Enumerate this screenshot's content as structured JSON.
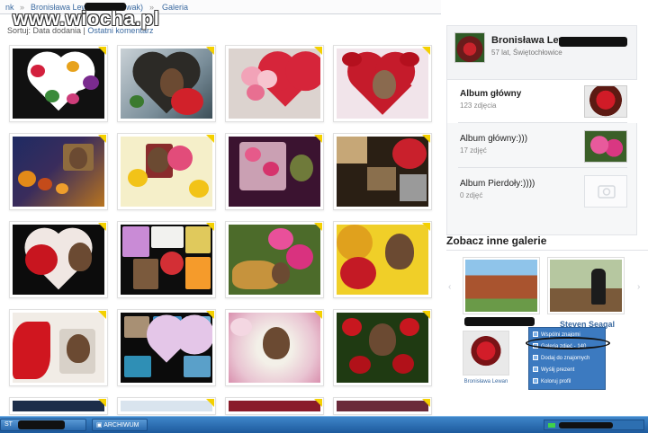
{
  "watermark": "www.wiocha.pl",
  "breadcrumb": {
    "items": [
      "nk",
      "Bronisława Lew",
      "wak)",
      "Galeria"
    ]
  },
  "sort": {
    "prefix": "Sortuj: Data dodania |",
    "option": "Ostatni komentarz"
  },
  "profile": {
    "name": "Bronisława Lew",
    "info": "57 lat, Świętochłowice"
  },
  "albums": [
    {
      "name": "Album główny",
      "count": "123 zdjęcia"
    },
    {
      "name": "Album główny:)))",
      "count": "17 zdjęć"
    },
    {
      "name": "Album Pierdoły:))))",
      "count": "0 zdjęć"
    }
  ],
  "others": {
    "header": "Zobacz inne galerie",
    "gallery2_name": "Steven Seagal",
    "mini_friend_name": "Bronisława Lewan"
  },
  "context_menu": {
    "items": [
      "Wspólni znajomi",
      "Galeria zdjęć - 140",
      "Dodaj do znajomych",
      "Wyślij prezent",
      "Koloruj profil"
    ]
  },
  "taskbar": {
    "start_label": "ST",
    "archive_label": "ARCHIWUM"
  },
  "colors": {
    "link": "#3b6aa0",
    "taskbar": "#1d5a9d",
    "menu": "#3c7ac0",
    "badge": "#f4d000"
  }
}
